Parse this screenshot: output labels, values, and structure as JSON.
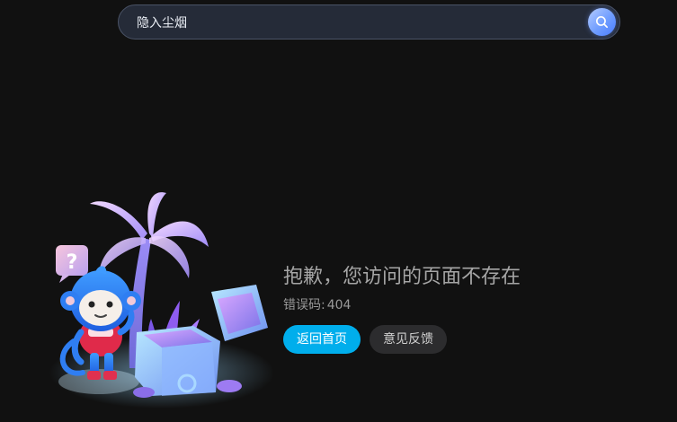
{
  "search": {
    "value": "隐入尘烟",
    "placeholder": ""
  },
  "icons": {
    "search_button": "search-icon",
    "illustration": "404-monkey-treasure-chest-illustration"
  },
  "error": {
    "title": "抱歉，您访问的页面不存在",
    "code_label": "错误码:",
    "code_value": "404"
  },
  "actions": {
    "home_label": "返回首页",
    "feedback_label": "意见反馈"
  },
  "colors": {
    "background": "#111111",
    "search_bg": "#252b38",
    "primary_button": "#00aeec",
    "secondary_button": "#2c2c2e",
    "title_text": "#a6a6a6"
  }
}
